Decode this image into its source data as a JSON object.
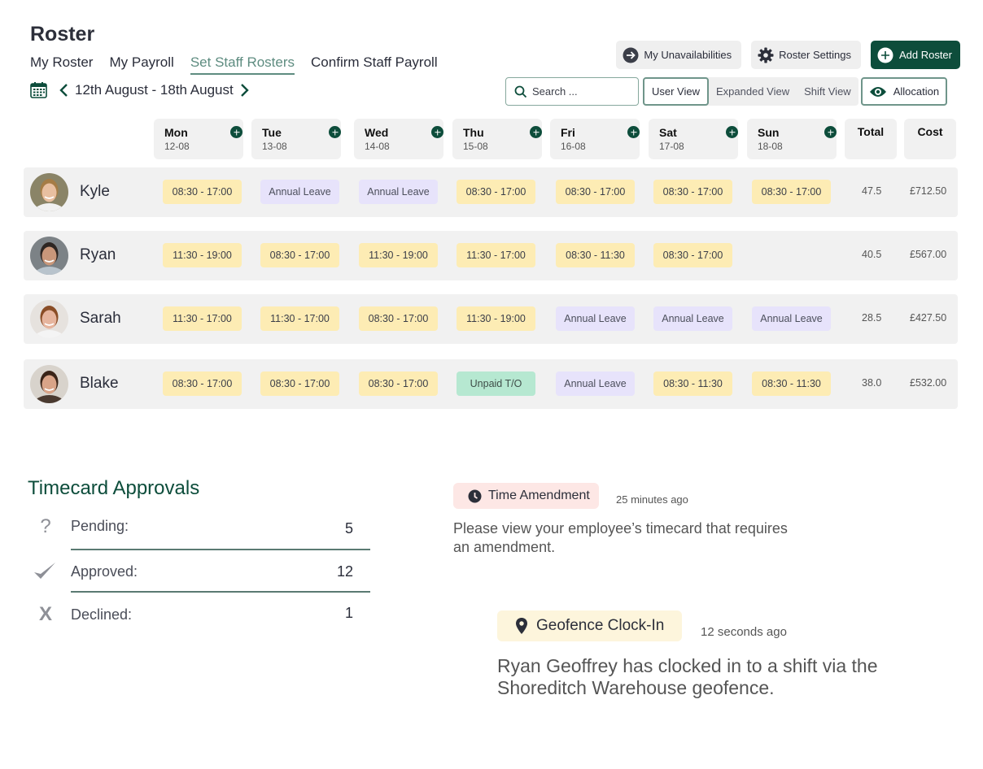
{
  "page": {
    "title": "Roster"
  },
  "nav": {
    "tabs": [
      {
        "label": "My Roster",
        "active": false
      },
      {
        "label": "My Payroll",
        "active": false
      },
      {
        "label": "Set Staff Rosters",
        "active": true
      },
      {
        "label": "Confirm Staff Payroll",
        "active": false
      }
    ]
  },
  "date_range": {
    "label": "12th August - 18th August"
  },
  "actions": {
    "unavailabilities": "My Unavailabilities",
    "roster_settings": "Roster Settings",
    "add_roster": "Add Roster"
  },
  "toolbar": {
    "search_placeholder": "Search ...",
    "views": [
      "User View",
      "Expanded View",
      "Shift View"
    ],
    "active_view": "User View",
    "allocation": "Allocation"
  },
  "schedule": {
    "days": [
      {
        "name": "Mon",
        "date": "12-08"
      },
      {
        "name": "Tue",
        "date": "13-08"
      },
      {
        "name": "Wed",
        "date": "14-08"
      },
      {
        "name": "Thu",
        "date": "15-08"
      },
      {
        "name": "Fri",
        "date": "16-08"
      },
      {
        "name": "Sat",
        "date": "17-08"
      },
      {
        "name": "Sun",
        "date": "18-08"
      }
    ],
    "total_label": "Total",
    "cost_label": "Cost",
    "employees": [
      {
        "name": "Kyle",
        "shifts": [
          {
            "text": "08:30 - 17:00",
            "type": "work"
          },
          {
            "text": "Annual Leave",
            "type": "leave"
          },
          {
            "text": "Annual Leave",
            "type": "leave"
          },
          {
            "text": "08:30 - 17:00",
            "type": "work"
          },
          {
            "text": "08:30 - 17:00",
            "type": "work"
          },
          {
            "text": "08:30 - 17:00",
            "type": "work"
          },
          {
            "text": "08:30 - 17:00",
            "type": "work"
          }
        ],
        "total": "47.5",
        "cost": "£712.50"
      },
      {
        "name": "Ryan",
        "shifts": [
          {
            "text": "11:30 - 19:00",
            "type": "work"
          },
          {
            "text": "08:30 - 17:00",
            "type": "work"
          },
          {
            "text": "11:30 - 19:00",
            "type": "work"
          },
          {
            "text": "11:30 - 17:00",
            "type": "work"
          },
          {
            "text": "08:30 - 11:30",
            "type": "work"
          },
          {
            "text": "08:30 - 17:00",
            "type": "work"
          },
          null
        ],
        "total": "40.5",
        "cost": "£567.00"
      },
      {
        "name": "Sarah",
        "shifts": [
          {
            "text": "11:30 - 17:00",
            "type": "work"
          },
          {
            "text": "11:30 - 17:00",
            "type": "work"
          },
          {
            "text": "08:30 - 17:00",
            "type": "work"
          },
          {
            "text": "11:30 - 19:00",
            "type": "work"
          },
          {
            "text": "Annual Leave",
            "type": "leave"
          },
          {
            "text": "Annual Leave",
            "type": "leave"
          },
          {
            "text": "Annual Leave",
            "type": "leave"
          }
        ],
        "total": "28.5",
        "cost": "£427.50"
      },
      {
        "name": "Blake",
        "shifts": [
          {
            "text": "08:30 - 17:00",
            "type": "work"
          },
          {
            "text": "08:30 - 17:00",
            "type": "work"
          },
          {
            "text": "08:30 - 17:00",
            "type": "work"
          },
          {
            "text": "Unpaid T/O",
            "type": "unpaid"
          },
          {
            "text": "Annual Leave",
            "type": "leave"
          },
          {
            "text": "08:30 - 11:30",
            "type": "work"
          },
          {
            "text": "08:30 - 11:30",
            "type": "work"
          }
        ],
        "total": "38.0",
        "cost": "£532.00"
      }
    ]
  },
  "timecards": {
    "title": "Timecard Approvals",
    "items": [
      {
        "icon": "question-icon",
        "label": "Pending:",
        "value": "5"
      },
      {
        "icon": "check-icon",
        "label": "Approved:",
        "value": "12"
      },
      {
        "icon": "x-icon",
        "label": "Declined:",
        "value": "1"
      }
    ]
  },
  "notifications": [
    {
      "icon": "clock-icon",
      "tag": "Time Amendment",
      "time": "25 minutes ago",
      "body": "Please view your employee’s timecard that requires an amendment.",
      "tag_color": "#fde7e5"
    },
    {
      "icon": "location-pin-icon",
      "tag": "Geofence Clock-In",
      "time": "12 seconds ago",
      "body": "Ryan Geoffrey has clocked in to a shift via the Shoreditch Warehouse geofence.",
      "tag_color": "#fdf5dc"
    }
  ],
  "colors": {
    "brand_green": "#0d4d3b",
    "accent_teal": "#5e8c80",
    "shift_work": "#fdecb4",
    "shift_leave": "#e7e3fb",
    "shift_unpaid": "#b6e8d1"
  }
}
